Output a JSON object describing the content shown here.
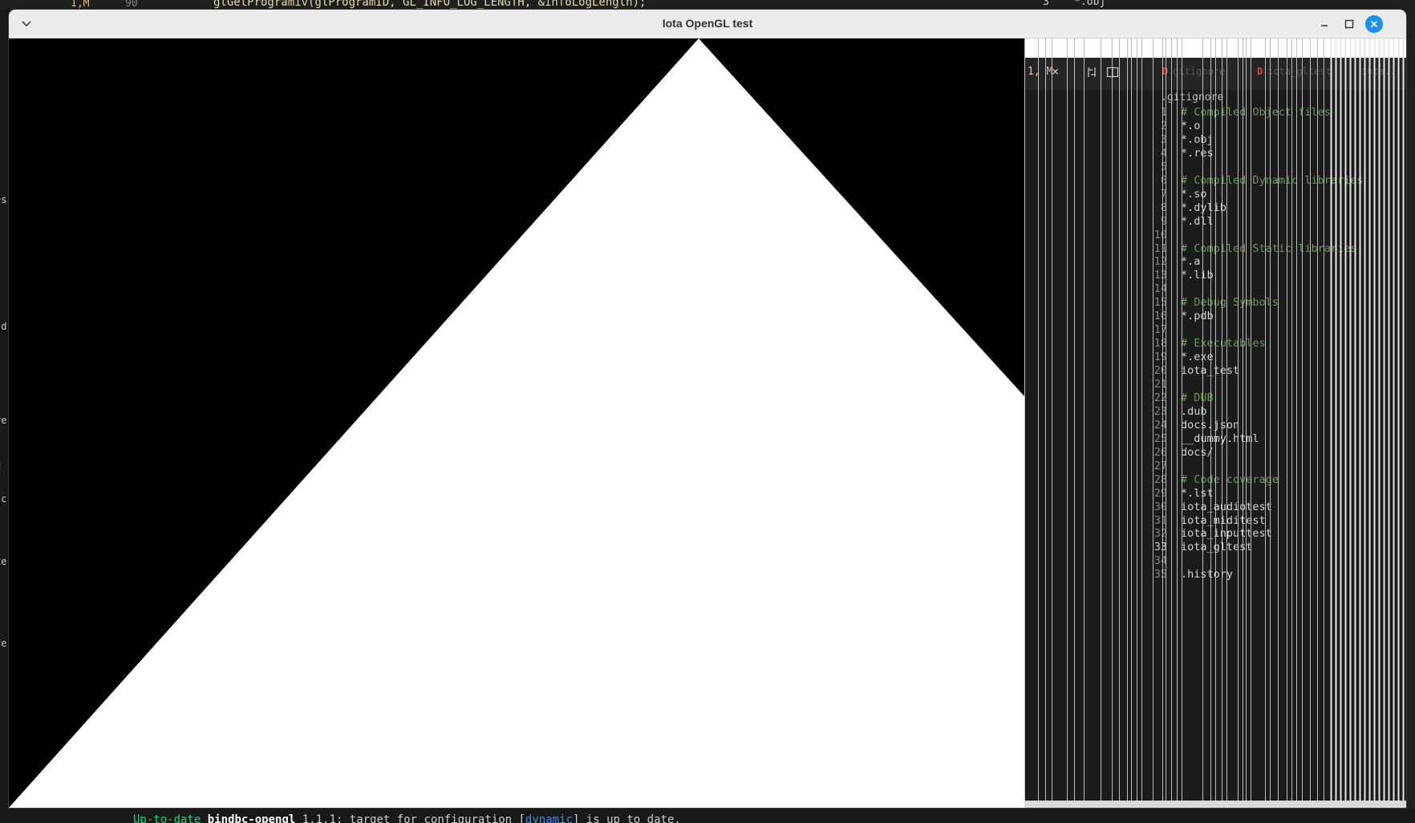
{
  "background": {
    "line_badge": "1,M",
    "line_number": "90",
    "code_line": "glGetProgramiv(glProgramID, GL_INFO_LOG_LENGTH, &infoLogLength);",
    "right_text": "3    *.obj",
    "left_fragments": [
      "es",
      ".d",
      "re",
      "d",
      "sc",
      "xe",
      "-",
      "de"
    ],
    "terminal": {
      "status": "Up-to-date",
      "package": "bindbc-opengl",
      "version": "1.1.1",
      "mid": ": target for configuration [",
      "config": "dynamic",
      "tail": "] is up to date."
    }
  },
  "window": {
    "title": "Iota OpenGL test",
    "icons": {
      "menu": "chevron-down-icon",
      "minimize": "minimize-icon",
      "maximize": "maximize-icon",
      "close": "close-icon"
    },
    "close_color": "#1c8ef0"
  },
  "gl_scene": {
    "shape": "triangle",
    "fill": "#ffffff",
    "clear_color": "#000000"
  },
  "stale_buffer": {
    "tab_modified": "1, M",
    "tab_close": "×",
    "tabs": [
      "gitignore",
      "iota_gltest",
      "iota..."
    ],
    "breadcrumb": ".gitignore",
    "lines": [
      {
        "n": "1",
        "t": "# Compiled Object files",
        "c": true
      },
      {
        "n": "2",
        "t": "*.o"
      },
      {
        "n": "3",
        "t": "*.obj"
      },
      {
        "n": "4",
        "t": "*.res"
      },
      {
        "n": "5",
        "t": ""
      },
      {
        "n": "6",
        "t": "# Compiled Dynamic libraries",
        "c": true
      },
      {
        "n": "7",
        "t": "*.so"
      },
      {
        "n": "8",
        "t": "*.dylib"
      },
      {
        "n": "9",
        "t": "*.dll"
      },
      {
        "n": "10",
        "t": ""
      },
      {
        "n": "11",
        "t": "# Compiled Static libraries",
        "c": true
      },
      {
        "n": "12",
        "t": "*.a"
      },
      {
        "n": "13",
        "t": "*.lib"
      },
      {
        "n": "14",
        "t": ""
      },
      {
        "n": "15",
        "t": "# Debug Symbols",
        "c": true
      },
      {
        "n": "16",
        "t": "*.pdb"
      },
      {
        "n": "17",
        "t": ""
      },
      {
        "n": "18",
        "t": "# Executables",
        "c": true
      },
      {
        "n": "19",
        "t": "*.exe"
      },
      {
        "n": "20",
        "t": "iota_test"
      },
      {
        "n": "21",
        "t": ""
      },
      {
        "n": "22",
        "t": "# DUB",
        "c": true
      },
      {
        "n": "23",
        "t": ".dub"
      },
      {
        "n": "24",
        "t": "docs.json"
      },
      {
        "n": "25",
        "t": "__dummy.html"
      },
      {
        "n": "26",
        "t": "docs/"
      },
      {
        "n": "27",
        "t": ""
      },
      {
        "n": "28",
        "t": "# Code coverage",
        "c": true
      },
      {
        "n": "29",
        "t": "*.lst"
      },
      {
        "n": "30",
        "t": "iota_audiotest"
      },
      {
        "n": "31",
        "t": "iota_miditest"
      },
      {
        "n": "32",
        "t": "iota_inputtest"
      },
      {
        "n": "33",
        "t": "iota_gltest",
        "active": true
      },
      {
        "n": "34",
        "t": ""
      },
      {
        "n": "35",
        "t": ".history"
      }
    ]
  }
}
